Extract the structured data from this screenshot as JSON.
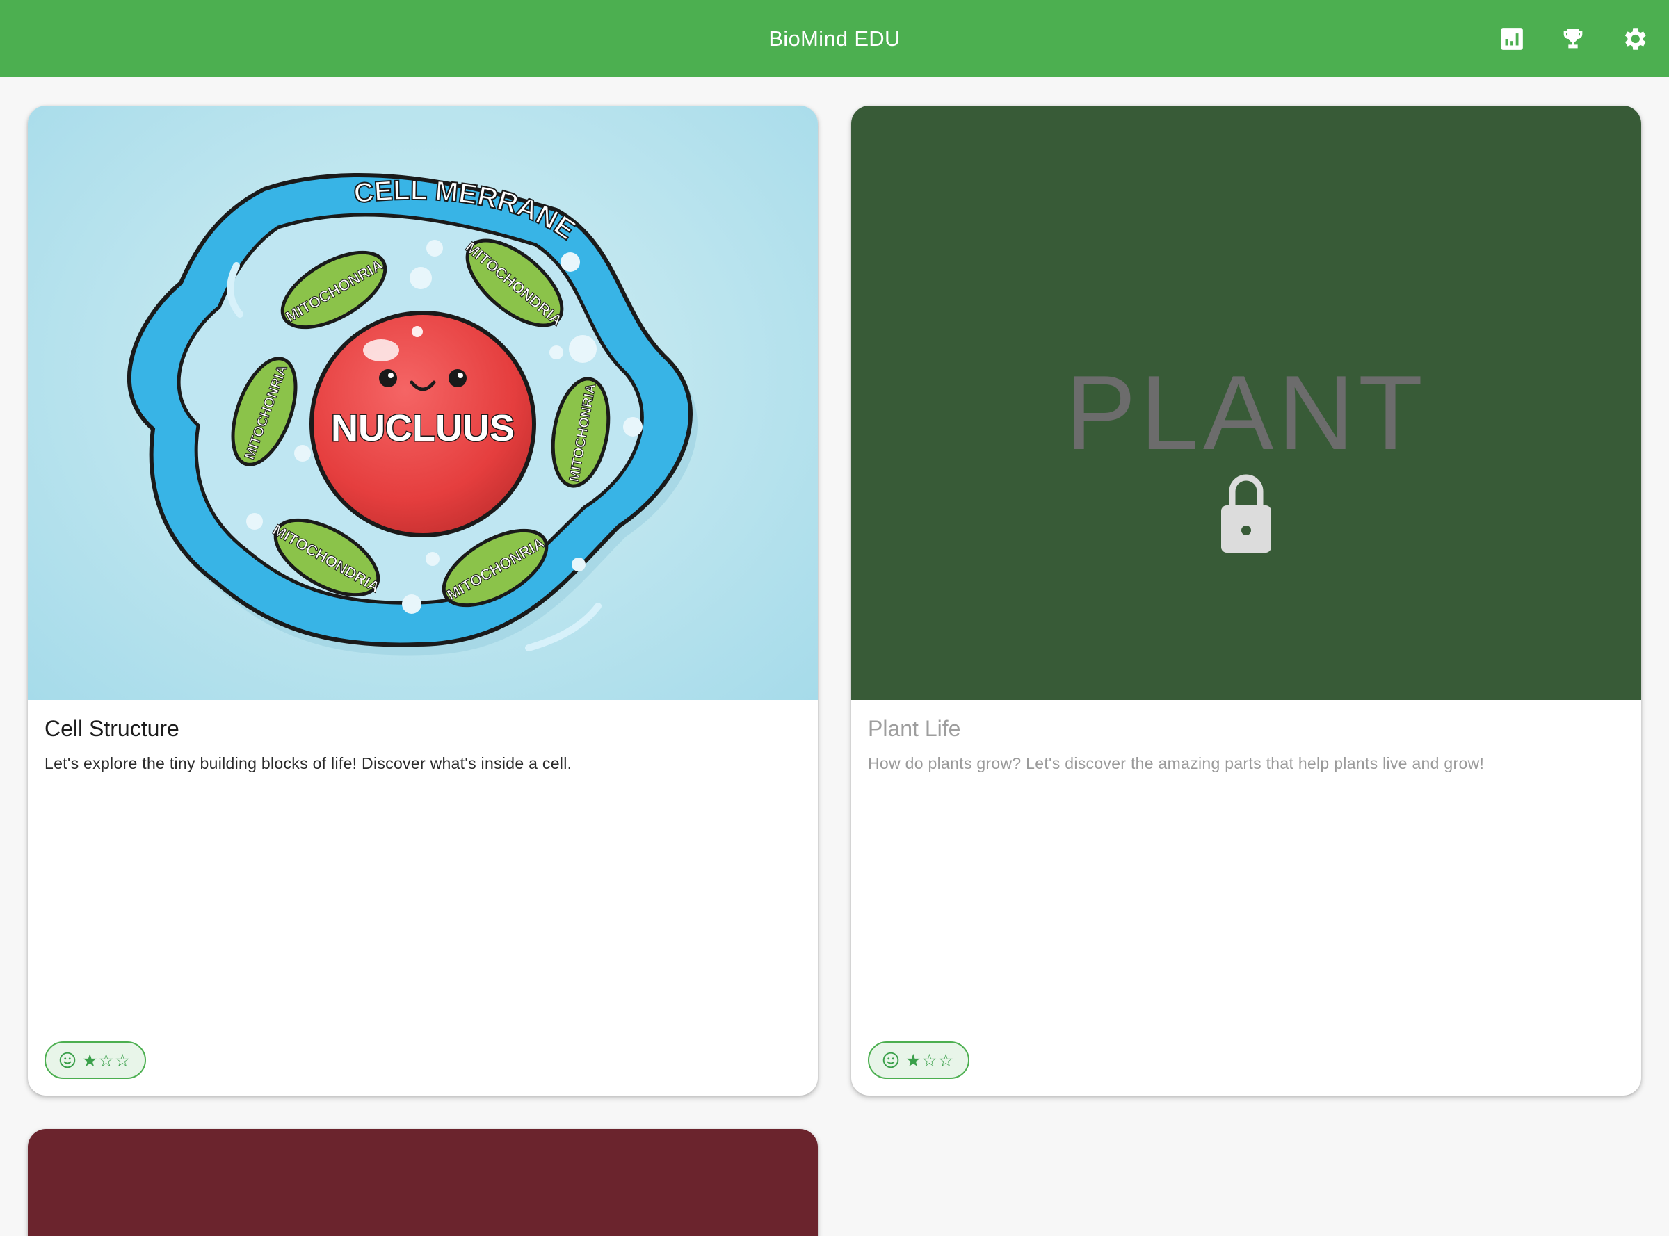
{
  "app": {
    "title": "BioMind EDU"
  },
  "actions": [
    {
      "name": "stats-icon"
    },
    {
      "name": "trophy-icon"
    },
    {
      "name": "settings-icon"
    }
  ],
  "cards": [
    {
      "title": "Cell Structure",
      "description": "Let's explore the tiny building blocks of life! Discover what's inside a cell.",
      "locked": false,
      "stars_filled": 1,
      "stars_total": 3,
      "stars_text": "★☆☆",
      "image_labels": {
        "membrane": "CELL MERRANE",
        "nucleus": "NUCLUUS",
        "mitochondria": "MITOCHONRIA",
        "mitochondria_alt": "MITOCHONDRIA"
      }
    },
    {
      "title": "Plant Life",
      "description": "How do plants grow? Let's discover the amazing parts that help plants live and grow!",
      "locked": true,
      "stars_filled": 1,
      "stars_total": 3,
      "stars_text": "★☆☆",
      "image_label": "PLANT"
    },
    {
      "locked": false
    }
  ],
  "colors": {
    "appbar": "#4caf50",
    "card2_image": "#385b37",
    "card3_image": "#6b242d",
    "chip_border": "#4caf50",
    "chip_bg": "#e8f5e9"
  }
}
